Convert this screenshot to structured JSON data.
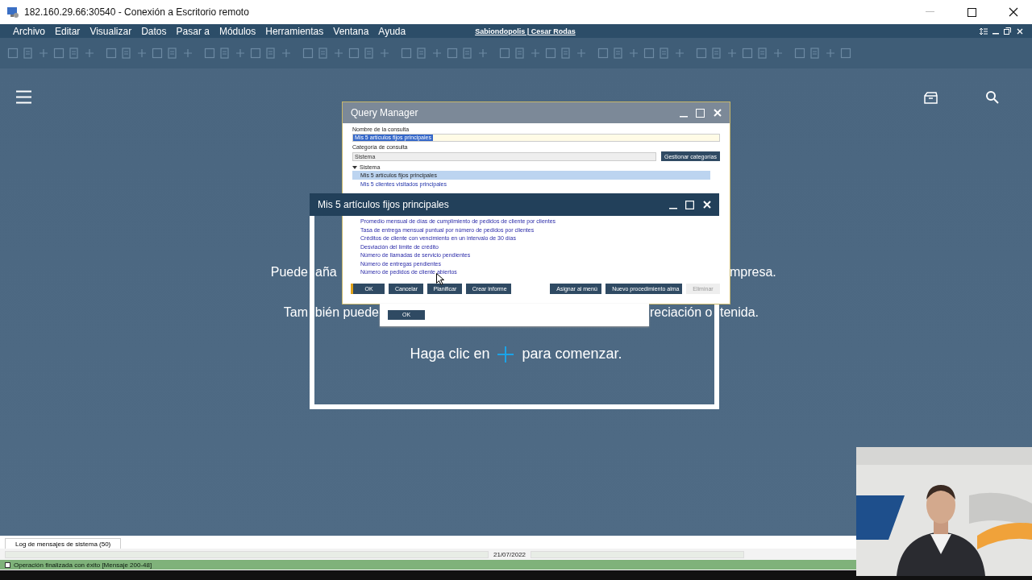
{
  "remote_window": {
    "title": "182.160.29.66:30540 - Conexión a Escritorio remoto"
  },
  "menu": [
    {
      "label": "Archivo"
    },
    {
      "label": "Editar"
    },
    {
      "label": "Visualizar"
    },
    {
      "label": "Datos"
    },
    {
      "label": "Pasar a"
    },
    {
      "label": "Módulos"
    },
    {
      "label": "Herramientas"
    },
    {
      "label": "Ventana"
    },
    {
      "label": "Ayuda"
    }
  ],
  "user": "Sabiondopolis | Cesar Rodas",
  "home": {
    "line_1_left": "Puede",
    "line_1_middle": "aña",
    "line_1_right": "mpresa.",
    "line_2_left": "Tam",
    "line_2_middle": "bién puede",
    "line_2_right": "reciación o",
    "line_2_end": "tenida.",
    "cta_before": "Haga clic en",
    "cta_after": "para comenzar."
  },
  "query_manager": {
    "title": "Query Manager",
    "name_label": "Nombre de la consulta",
    "name_value": "Mis 5 artículos fijos principales",
    "category_label": "Categoría de consulta",
    "category_value": "Sistema",
    "manage_button": "Gestionar categorías",
    "tree": [
      {
        "label": "Sistema",
        "expanded": true,
        "children": [
          {
            "label": "Mis 5 artículos fijos principales",
            "selected": true
          },
          {
            "label": "Mis 5 clientes visitados principales",
            "selected": false
          }
        ]
      }
    ],
    "queries": [
      "Promedio mensual de días de cumplimiento de pedidos de cliente por clientes",
      "Tasa de entrega mensual puntual por número de pedidos por clientes",
      "Créditos de cliente con vencimiento en un intervalo de 30 días",
      "Desviación del límite de crédito",
      "Número de llamadas de servicio pendientes",
      "Número de entregas pendientes",
      "Número de pedidos de cliente abiertos"
    ],
    "buttons": [
      {
        "label": "OK",
        "kind": "default",
        "disabled": false
      },
      {
        "label": "Cancelar",
        "kind": "normal",
        "disabled": false
      },
      {
        "label": "Planificar",
        "kind": "normal",
        "disabled": false
      },
      {
        "label": "Crear informe",
        "kind": "normal",
        "disabled": false
      },
      {
        "label": "Asignar al menú",
        "kind": "right",
        "disabled": false
      },
      {
        "label": "Nuevo procedimiento alma",
        "kind": "right",
        "disabled": false
      },
      {
        "label": "Eliminar",
        "kind": "right",
        "disabled": true
      }
    ]
  },
  "result_window": {
    "title": "Mis 5 artículos fijos principales"
  },
  "message_box": {
    "button": "OK"
  },
  "log": {
    "tab": "Log de mensajes de sistema (50)",
    "date": "21/07/2022",
    "message": "Operación finalizada con éxito  [Mensaje 200-48]"
  }
}
